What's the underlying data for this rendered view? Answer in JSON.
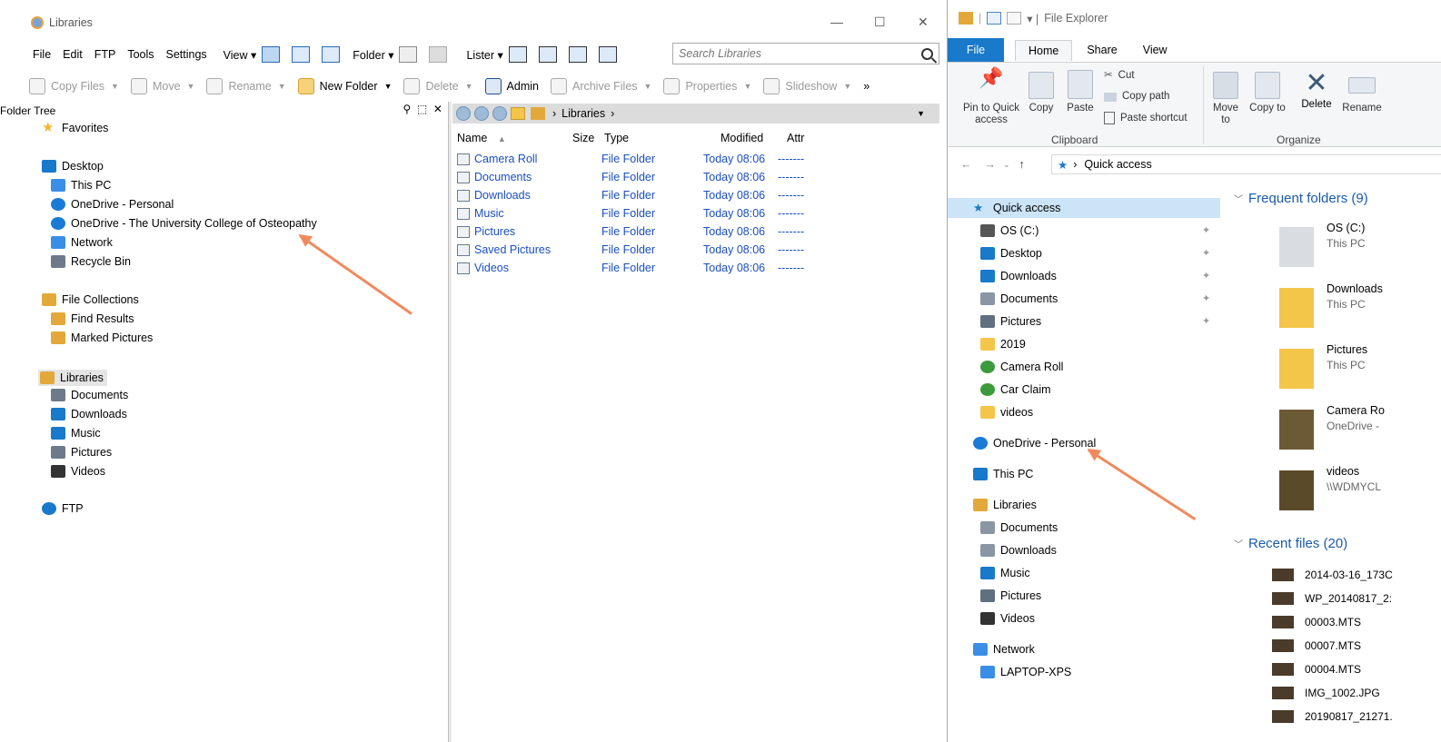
{
  "left_window": {
    "title": "Libraries",
    "controls": {
      "minimize": "—",
      "maximize": "☐",
      "close": "✕"
    },
    "menu": [
      "File",
      "Edit",
      "FTP",
      "Tools",
      "Settings"
    ],
    "view_label": "View ▾",
    "folder_label": "Folder ▾",
    "lister_label": "Lister ▾",
    "search_placeholder": "Search Libraries",
    "toolbar": {
      "copy_files": "Copy Files",
      "move": "Move",
      "rename": "Rename",
      "new_folder": "New Folder",
      "delete": "Delete",
      "admin": "Admin",
      "archive_files": "Archive Files",
      "properties": "Properties",
      "slideshow": "Slideshow",
      "more": "»"
    },
    "folder_tree_label": "Folder Tree",
    "tree": [
      {
        "label": "Favorites",
        "icon": "star-icon",
        "color": "#f2b632"
      },
      {
        "label": "Desktop",
        "icon": "desktop-icon",
        "color": "#1979ca"
      },
      {
        "label": "This PC",
        "icon": "monitor-icon",
        "color": "#3a8ee6"
      },
      {
        "label": "OneDrive - Personal",
        "icon": "onedrive-synced-icon",
        "color": "#1a7bd6"
      },
      {
        "label": "OneDrive - The University College of Osteopathy",
        "icon": "onedrive-icon",
        "color": "#1a7bd6"
      },
      {
        "label": "Network",
        "icon": "network-icon",
        "color": "#3a8ee6"
      },
      {
        "label": "Recycle Bin",
        "icon": "recycle-bin-icon",
        "color": "#6c7a89"
      },
      {
        "label": "File Collections",
        "icon": "collections-icon",
        "color": "#e2a93a"
      },
      {
        "label": "Find Results",
        "icon": "find-results-icon",
        "color": "#e2a93a"
      },
      {
        "label": "Marked Pictures",
        "icon": "marked-pictures-icon",
        "color": "#e2a93a"
      },
      {
        "label": "Libraries",
        "icon": "libraries-icon",
        "color": "#e2a93a"
      },
      {
        "label": "Documents",
        "icon": "documents-icon",
        "color": "#6c7a89"
      },
      {
        "label": "Downloads",
        "icon": "downloads-icon",
        "color": "#1979ca"
      },
      {
        "label": "Music",
        "icon": "music-icon",
        "color": "#1979ca"
      },
      {
        "label": "Pictures",
        "icon": "pictures-icon",
        "color": "#6c7a89"
      },
      {
        "label": "Videos",
        "icon": "videos-icon",
        "color": "#333333"
      },
      {
        "label": "FTP",
        "icon": "ftp-icon",
        "color": "#1979ca"
      }
    ],
    "path_crumb": "Libraries",
    "columns": {
      "name": "Name",
      "size": "Size",
      "type": "Type",
      "modified": "Modified",
      "attr": "Attr"
    },
    "files": [
      {
        "name": "Camera Roll",
        "type": "File Folder",
        "modified": "Today  08:06",
        "attr": "-------"
      },
      {
        "name": "Documents",
        "type": "File Folder",
        "modified": "Today  08:06",
        "attr": "-------"
      },
      {
        "name": "Downloads",
        "type": "File Folder",
        "modified": "Today  08:06",
        "attr": "-------"
      },
      {
        "name": "Music",
        "type": "File Folder",
        "modified": "Today  08:06",
        "attr": "-------"
      },
      {
        "name": "Pictures",
        "type": "File Folder",
        "modified": "Today  08:06",
        "attr": "-------"
      },
      {
        "name": "Saved Pictures",
        "type": "File Folder",
        "modified": "Today  08:06",
        "attr": "-------"
      },
      {
        "name": "Videos",
        "type": "File Folder",
        "modified": "Today  08:06",
        "attr": "-------"
      }
    ]
  },
  "right_window": {
    "title": "File Explorer",
    "tabs": {
      "file": "File",
      "home": "Home",
      "share": "Share",
      "view": "View"
    },
    "ribbon": {
      "pin": "Pin to Quick access",
      "copy": "Copy",
      "paste": "Paste",
      "cut": "Cut",
      "copy_path": "Copy path",
      "paste_shortcut": "Paste shortcut",
      "move_to": "Move to",
      "copy_to": "Copy to",
      "delete": "Delete",
      "rename": "Rename",
      "clipboard_group": "Clipboard",
      "organize_group": "Organize"
    },
    "address": "Quick access",
    "nav": [
      {
        "label": "Quick access",
        "pinned": false
      },
      {
        "label": "OS (C:)",
        "pinned": true
      },
      {
        "label": "Desktop",
        "pinned": true
      },
      {
        "label": "Downloads",
        "pinned": true
      },
      {
        "label": "Documents",
        "pinned": true
      },
      {
        "label": "Pictures",
        "pinned": true
      },
      {
        "label": "2019",
        "pinned": false
      },
      {
        "label": "Camera Roll",
        "pinned": false
      },
      {
        "label": "Car Claim",
        "pinned": false
      },
      {
        "label": "videos",
        "pinned": false
      },
      {
        "label": "OneDrive - Personal",
        "pinned": false
      },
      {
        "label": "This PC",
        "pinned": false
      },
      {
        "label": "Libraries",
        "pinned": false
      },
      {
        "label": "Documents",
        "pinned": false
      },
      {
        "label": "Downloads",
        "pinned": false
      },
      {
        "label": "Music",
        "pinned": false
      },
      {
        "label": "Pictures",
        "pinned": false
      },
      {
        "label": "Videos",
        "pinned": false
      },
      {
        "label": "Network",
        "pinned": false
      },
      {
        "label": "LAPTOP-XPS",
        "pinned": false
      }
    ],
    "frequent_header": "Frequent folders (9)",
    "frequent": [
      {
        "name": "OS (C:)",
        "sub": "This PC"
      },
      {
        "name": "Downloads",
        "sub": "This PC"
      },
      {
        "name": "Pictures",
        "sub": "This PC"
      },
      {
        "name": "Camera Ro",
        "sub": "OneDrive -"
      },
      {
        "name": "videos",
        "sub": "\\\\WDMYCL"
      }
    ],
    "recent_header": "Recent files (20)",
    "recent": [
      "2014-03-16_173C",
      "WP_20140817_2:",
      "00003.MTS",
      "00007.MTS",
      "00004.MTS",
      "IMG_1002.JPG",
      "20190817_21271."
    ]
  }
}
